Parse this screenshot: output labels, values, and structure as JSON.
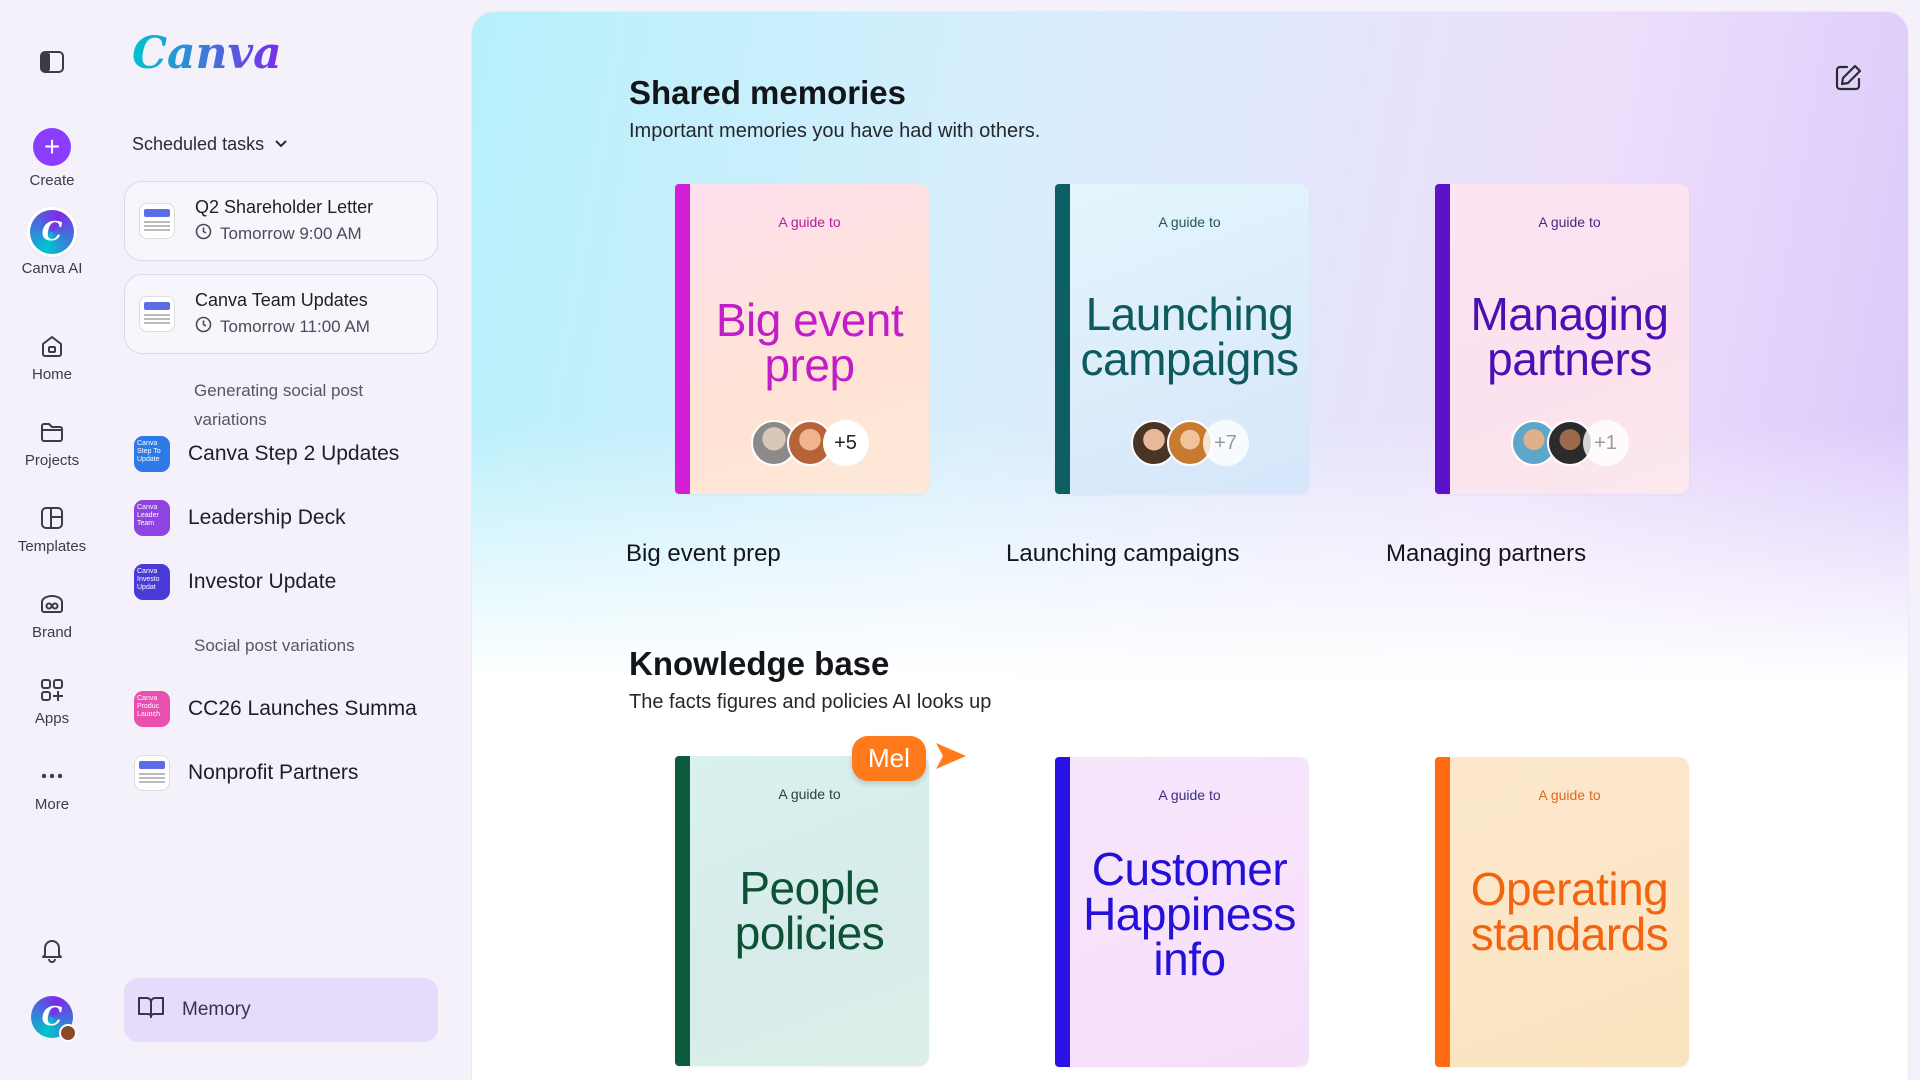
{
  "rail": {
    "create_label": "Create",
    "ai_label": "Canva AI",
    "home_label": "Home",
    "projects_label": "Projects",
    "templates_label": "Templates",
    "brand_label": "Brand",
    "apps_label": "Apps",
    "more_label": "More"
  },
  "panel": {
    "logo": "Canva",
    "scheduled_label": "Scheduled tasks",
    "tasks": [
      {
        "title": "Q2 Shareholder Letter",
        "time": "Tomorrow 9:00 AM"
      },
      {
        "title": "Canva Team Updates",
        "time": "Tomorrow 11:00 AM"
      }
    ],
    "group1_label_line1": "Generating social post",
    "group1_label_line2": "variations",
    "group1_items": [
      {
        "label": "Canva Step 2 Updates",
        "thumb_text": "Canva Step To Update",
        "color": "#2d7be8"
      },
      {
        "label": "Leadership Deck",
        "thumb_text": "Canva Leader Team",
        "color": "#8e44e0"
      },
      {
        "label": "Investor Update",
        "thumb_text": "Canva Investo Updat",
        "color": "#4a3bd6"
      }
    ],
    "group2_label": "Social post variations",
    "group2_items": [
      {
        "label": "CC26 Launches Summa",
        "thumb_text": "Canva Produc Launch",
        "color": "#e84fae"
      },
      {
        "label": "Nonprofit Partners",
        "thumb_text": "",
        "color": "#ffffff"
      }
    ],
    "memory_label": "Memory"
  },
  "shared": {
    "title": "Shared memories",
    "subtitle": "Important memories you have had with others.",
    "books": [
      {
        "guide": "A guide to",
        "title_l1": "Big event",
        "title_l2": "prep",
        "more": "+5",
        "caption": "Big event prep",
        "spine": "#d21fd5",
        "text_color": "#c21ec7",
        "guide_color": "#b3209f"
      },
      {
        "guide": "A guide to",
        "title_l1": "Launching",
        "title_l2": "campaigns",
        "more": "+7",
        "caption": "Launching campaigns",
        "spine": "#0d5f63",
        "text_color": "#0d5a5f",
        "guide_color": "#24555a"
      },
      {
        "guide": "A guide to",
        "title_l1": "Managing",
        "title_l2": "partners",
        "more": "+1",
        "caption": "Managing partners",
        "spine": "#5b12c9",
        "text_color": "#4b10b3",
        "guide_color": "#4b2a80"
      }
    ]
  },
  "knowledge": {
    "title": "Knowledge base",
    "subtitle": "The facts figures and policies AI looks up",
    "books": [
      {
        "guide": "A guide to",
        "title_l1": "People",
        "title_l2": "policies",
        "title_l3": "",
        "spine": "#0e5a3c",
        "text_color": "#0e5236",
        "guide_color": "#26453a"
      },
      {
        "guide": "A guide to",
        "title_l1": "Customer",
        "title_l2": "Happiness",
        "title_l3": "info",
        "spine": "#2a12e6",
        "text_color": "#2410d6",
        "guide_color": "#3a2e80"
      },
      {
        "guide": "A guide to",
        "title_l1": "Operating",
        "title_l2": "standards",
        "title_l3": "",
        "spine": "#ff6a12",
        "text_color": "#f26410",
        "guide_color": "#d86a20"
      }
    ]
  },
  "cursor_tag": "Mel",
  "colors": {
    "accent": "#8b3dff",
    "cursor": "#ff7a1a"
  }
}
